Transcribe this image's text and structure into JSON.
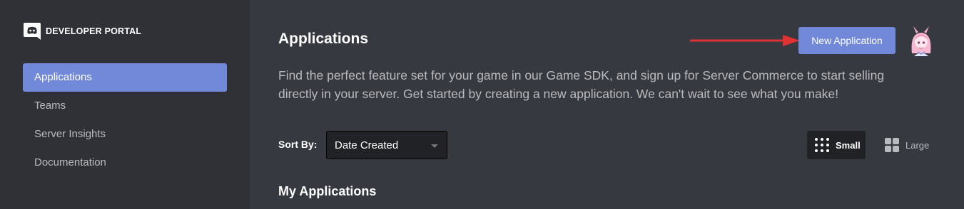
{
  "brand": {
    "title": "DEVELOPER PORTAL",
    "logo_icon": "discord-logo-icon"
  },
  "sidebar": {
    "items": [
      {
        "label": "Applications",
        "active": true
      },
      {
        "label": "Teams",
        "active": false
      },
      {
        "label": "Server Insights",
        "active": false
      },
      {
        "label": "Documentation",
        "active": false
      }
    ]
  },
  "header": {
    "title": "Applications",
    "new_app_label": "New Application",
    "annotation_icon": "red-arrow-icon",
    "avatar_icon": "anime-avatar-icon"
  },
  "main": {
    "description": "Find the perfect feature set for your game in our Game SDK, and sign up for Server Commerce to start selling directly in your server. Get started by creating a new application. We can't wait to see what you make!",
    "sort_label": "Sort By:",
    "sort_value": "Date Created",
    "view_small_label": "Small",
    "view_large_label": "Large",
    "section_title": "My Applications"
  },
  "colors": {
    "accent": "#7289da",
    "sidebar_bg": "#2f3136",
    "main_bg": "#36393f",
    "arrow": "#e03232"
  }
}
